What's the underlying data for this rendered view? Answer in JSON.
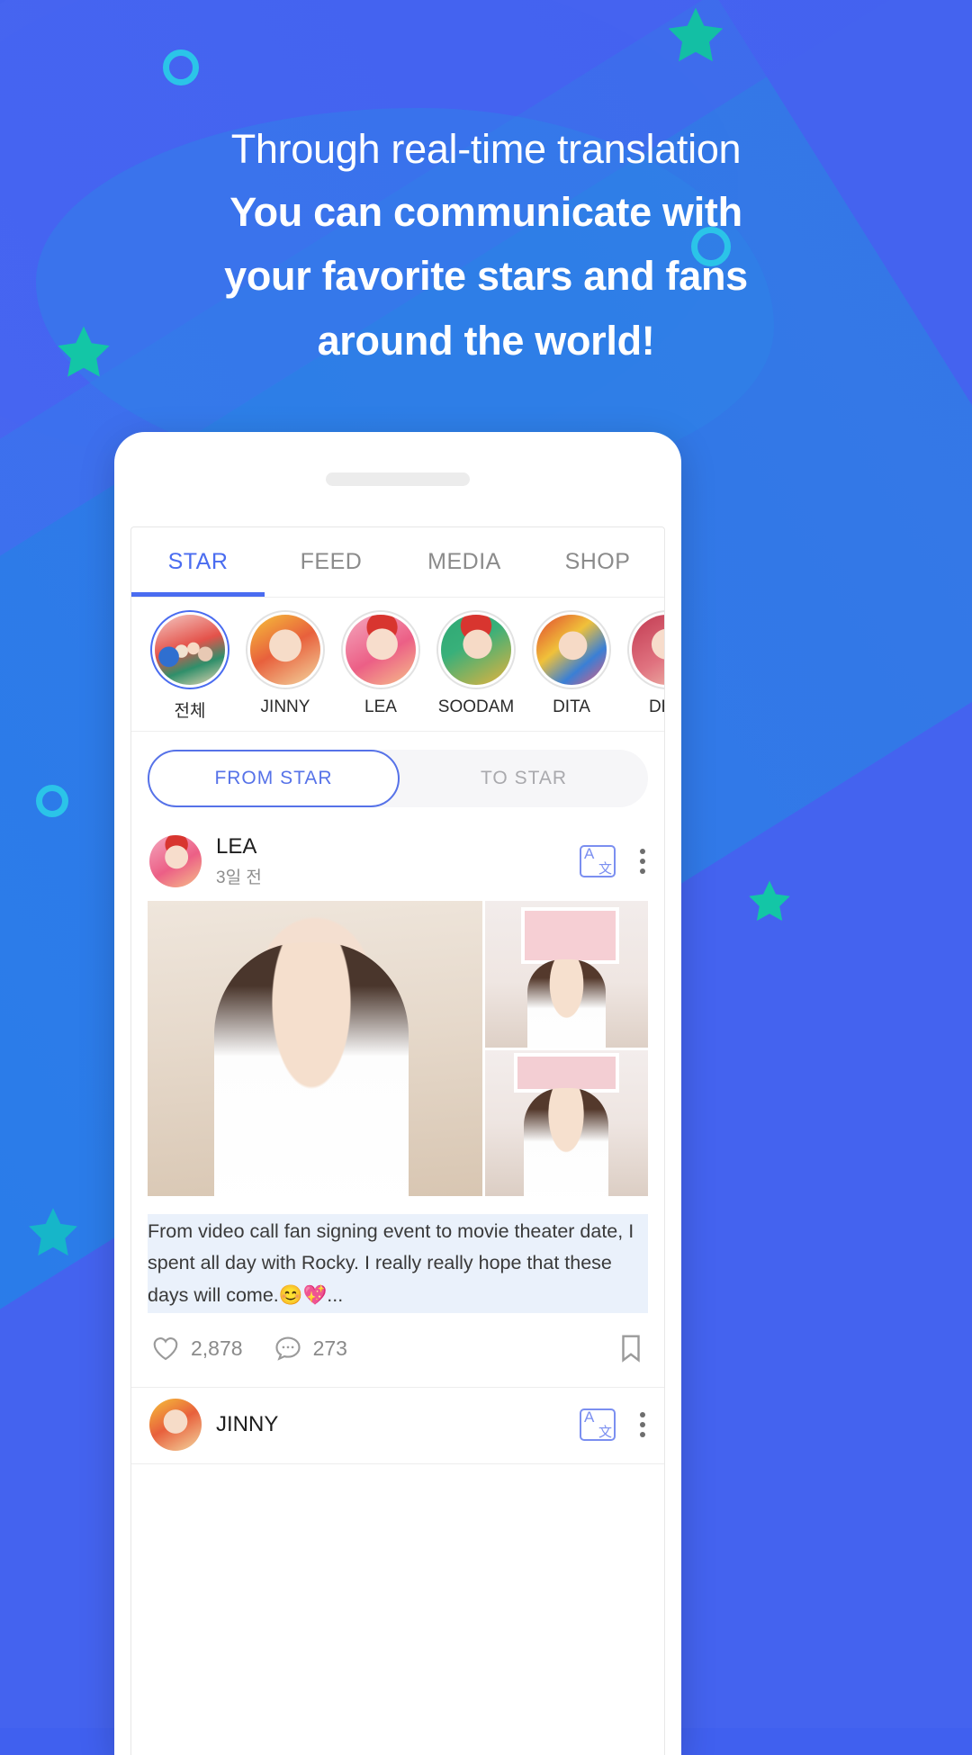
{
  "promo": {
    "line1": "Through real-time translation",
    "line2": "You can communicate with",
    "line3": "your favorite stars and fans",
    "line4": "around the world!",
    "bg_color": "#4463ef",
    "accent_blue": "#2f7fe0",
    "star_color": "#1ec8a8",
    "ring_color": "#2bc4e8"
  },
  "app": {
    "tabs": [
      {
        "label": "STAR",
        "active": true
      },
      {
        "label": "FEED",
        "active": false
      },
      {
        "label": "MEDIA",
        "active": false
      },
      {
        "label": "SHOP",
        "active": false
      }
    ],
    "active_tab_color": "#4a6cf0",
    "stories": [
      {
        "name": "전체",
        "selected": true
      },
      {
        "name": "JINNY",
        "selected": false
      },
      {
        "name": "LEA",
        "selected": false
      },
      {
        "name": "SOODAM",
        "selected": false
      },
      {
        "name": "DITA",
        "selected": false
      },
      {
        "name": "DEN",
        "selected": false
      }
    ],
    "segmented": {
      "from_star": "FROM STAR",
      "to_star": "TO STAR",
      "selected": "FROM STAR"
    },
    "posts": [
      {
        "author": "LEA",
        "time": "3일 전",
        "caption": "From video call fan signing event to movie theater date, I spent all day with Rocky. I really really hope that these days will come.😊💖...",
        "likes": "2,878",
        "comments": "273"
      },
      {
        "author": "JINNY",
        "time": "",
        "caption": "",
        "likes": "",
        "comments": ""
      }
    ]
  }
}
